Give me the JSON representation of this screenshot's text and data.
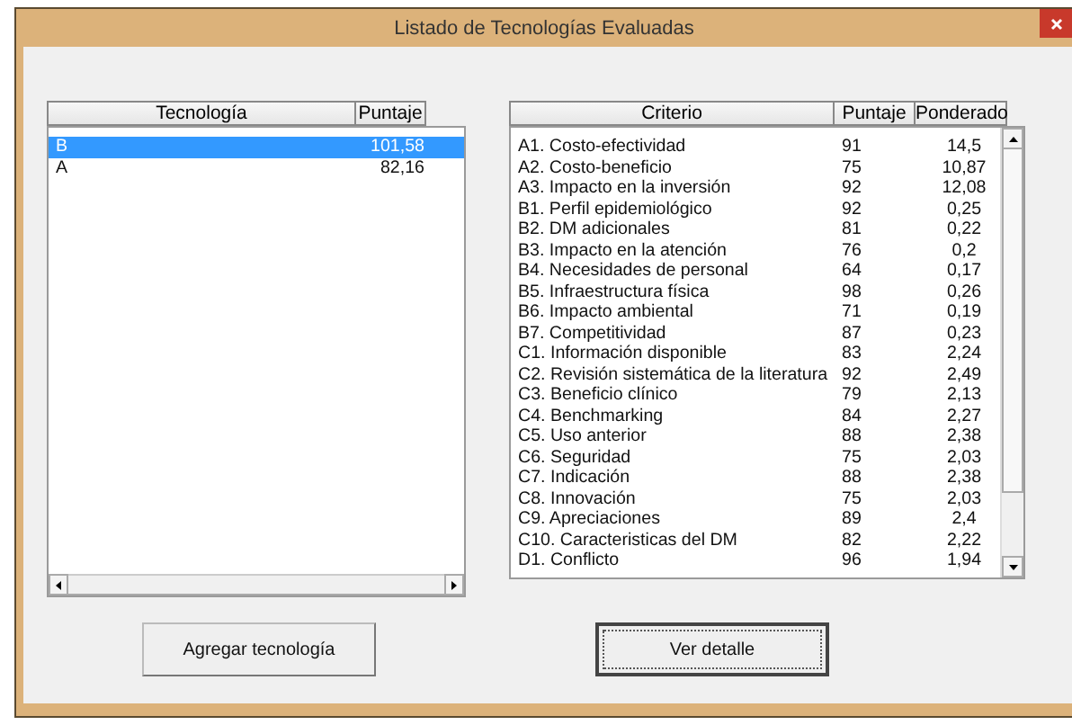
{
  "window": {
    "title": "Listado de Tecnologías Evaluadas"
  },
  "technology_list": {
    "columns": [
      "Tecnología",
      "Puntaje"
    ],
    "rows": [
      {
        "cells": [
          "B",
          "101,58"
        ],
        "selected": true
      },
      {
        "cells": [
          "A",
          "82,16"
        ],
        "selected": false
      }
    ]
  },
  "criteria_list": {
    "columns": [
      "Criterio",
      "Puntaje",
      "Ponderado"
    ],
    "rows": [
      {
        "cells": [
          "A1. Costo-efectividad",
          "91",
          "14,5"
        ]
      },
      {
        "cells": [
          "A2. Costo-beneficio",
          "75",
          "10,87"
        ]
      },
      {
        "cells": [
          "A3. Impacto en la inversión",
          "92",
          "12,08"
        ]
      },
      {
        "cells": [
          "B1. Perfil epidemiológico",
          "92",
          "0,25"
        ]
      },
      {
        "cells": [
          "B2. DM adicionales",
          "81",
          "0,22"
        ]
      },
      {
        "cells": [
          "B3. Impacto en la atención",
          "76",
          "0,2"
        ]
      },
      {
        "cells": [
          "B4. Necesidades de personal",
          "64",
          "0,17"
        ]
      },
      {
        "cells": [
          "B5. Infraestructura física",
          "98",
          "0,26"
        ]
      },
      {
        "cells": [
          "B6. Impacto ambiental",
          "71",
          "0,19"
        ]
      },
      {
        "cells": [
          "B7. Competitividad",
          "87",
          "0,23"
        ]
      },
      {
        "cells": [
          "C1. Información disponible",
          "83",
          "2,24"
        ]
      },
      {
        "cells": [
          "C2. Revisión sistemática de la literatura",
          "92",
          "2,49"
        ]
      },
      {
        "cells": [
          "C3. Beneficio clínico",
          "79",
          "2,13"
        ]
      },
      {
        "cells": [
          "C4. Benchmarking",
          "84",
          "2,27"
        ]
      },
      {
        "cells": [
          "C5. Uso anterior",
          "88",
          "2,38"
        ]
      },
      {
        "cells": [
          "C6. Seguridad",
          "75",
          "2,03"
        ]
      },
      {
        "cells": [
          "C7. Indicación",
          "88",
          "2,38"
        ]
      },
      {
        "cells": [
          "C8. Innovación",
          "75",
          "2,03"
        ]
      },
      {
        "cells": [
          "C9. Apreciaciones",
          "89",
          "2,4"
        ]
      },
      {
        "cells": [
          "C10. Caracteristicas del DM",
          "82",
          "2,22"
        ]
      },
      {
        "cells": [
          "D1. Conflicto",
          "96",
          "1,94"
        ]
      }
    ]
  },
  "buttons": [
    {
      "label": "Agregar tecnología",
      "focused": false
    },
    {
      "label": "Ver detalle",
      "focused": true
    }
  ]
}
